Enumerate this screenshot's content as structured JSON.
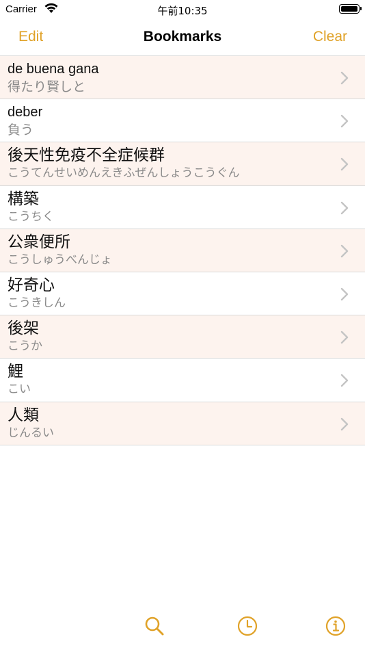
{
  "status_bar": {
    "carrier": "Carrier",
    "time": "午前10:35",
    "wifi_icon": "wifi-icon",
    "battery_icon": "battery-icon"
  },
  "nav": {
    "left_label": "Edit",
    "title": "Bookmarks",
    "right_label": "Clear"
  },
  "bookmarks": [
    {
      "word": "de buena gana",
      "sub": "得たり賢しと"
    },
    {
      "word": "deber",
      "sub": "負う"
    },
    {
      "word": "後天性免疫不全症候群",
      "sub": "こうてんせいめんえきふぜんしょうこうぐん"
    },
    {
      "word": "構築",
      "sub": "こうちく"
    },
    {
      "word": "公衆便所",
      "sub": "こうしゅうべんじょ"
    },
    {
      "word": "好奇心",
      "sub": "こうきしん"
    },
    {
      "word": "後架",
      "sub": "こうか"
    },
    {
      "word": "鯉",
      "sub": "こい"
    },
    {
      "word": "人類",
      "sub": "じんるい"
    }
  ],
  "tab_bar": {
    "items": [
      "search-icon",
      "clock-icon",
      "info-icon"
    ]
  },
  "colors": {
    "accent": "#e0a228",
    "row_alt": "#fdf3ee",
    "subtext": "#8a8a8a",
    "chevron": "#c4c4c4"
  }
}
